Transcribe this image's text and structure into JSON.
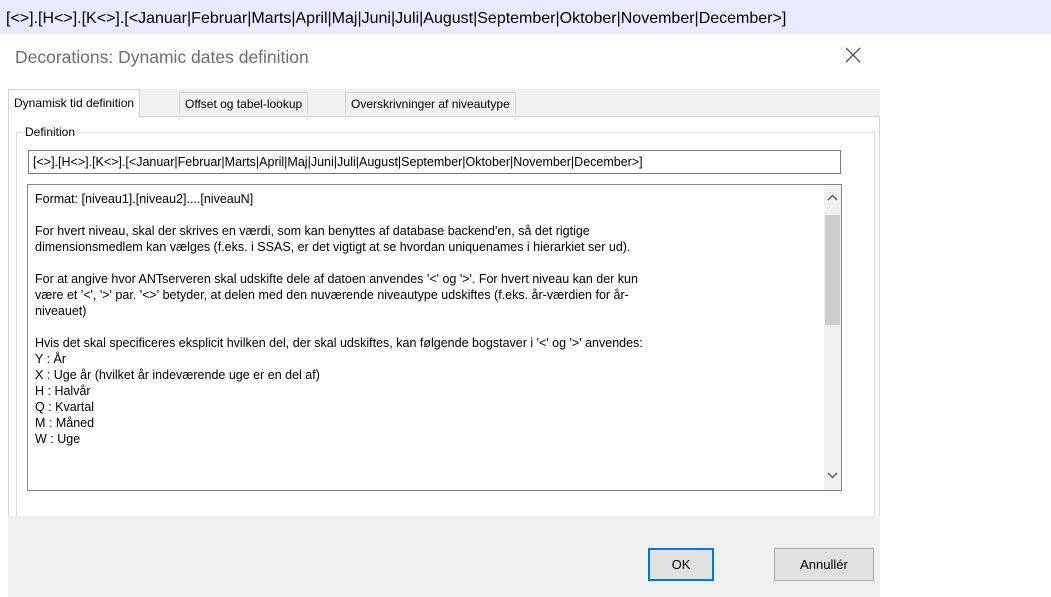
{
  "topbar": {
    "text": "[<>].[H<>].[K<>].[<Januar|Februar|Marts|April|Maj|Juni|Juli|August|September|Oktober|November|December>]"
  },
  "dialog": {
    "title": "Decorations: Dynamic dates definition",
    "close_icon": "close-icon",
    "tabs": [
      {
        "label": "Dynamisk tid definition",
        "active": true
      },
      {
        "label": "Offset og tabel-lookup",
        "active": false
      },
      {
        "label": "Overskrivninger af niveautype",
        "active": false
      }
    ],
    "group_label": "Definition",
    "definition_value": "[<>].[H<>].[K<>].[<Januar|Februar|Marts|April|Maj|Juni|Juli|August|September|Oktober|November|December>]",
    "help_lines": [
      "Format: [niveau1].[niveau2]....[niveauN]",
      "",
      "For hvert niveau, skal der skrives en værdi, som kan benyttes af database backend'en, så det rigtige",
      "dimensionsmedlem kan vælges (f.eks. i SSAS, er det vigtigt at se hvordan uniquenames i hierarkiet ser ud).",
      "",
      "For at angive hvor ANTserveren skal udskifte dele af datoen anvendes '<' og '>'. For hvert niveau kan der kun",
      "være et '<', '>' par. '<>' betyder, at delen med den nuværende niveautype udskiftes (f.eks. år-værdien for år-",
      "niveauet)",
      "",
      "Hvis det skal specificeres eksplicit hvilken del, der skal udskiftes, kan følgende bogstaver i '<' og '>' anvendes:",
      "Y : År",
      "X : Uge år (hvilket år indeværende uge er en del af)",
      "H : Halvår",
      "Q : Kvartal",
      "M : Måned",
      "W : Uge"
    ],
    "scroll_up_icon": "chevron-up-icon",
    "scroll_down_icon": "chevron-down-icon",
    "ok_label": "OK",
    "cancel_label": "Annullér",
    "colors": {
      "topbar_bg": "#e9e9ff",
      "dialog_bg": "#ffffff",
      "footer_bg": "#f0f0f0",
      "default_button_border": "#0078d7"
    }
  }
}
